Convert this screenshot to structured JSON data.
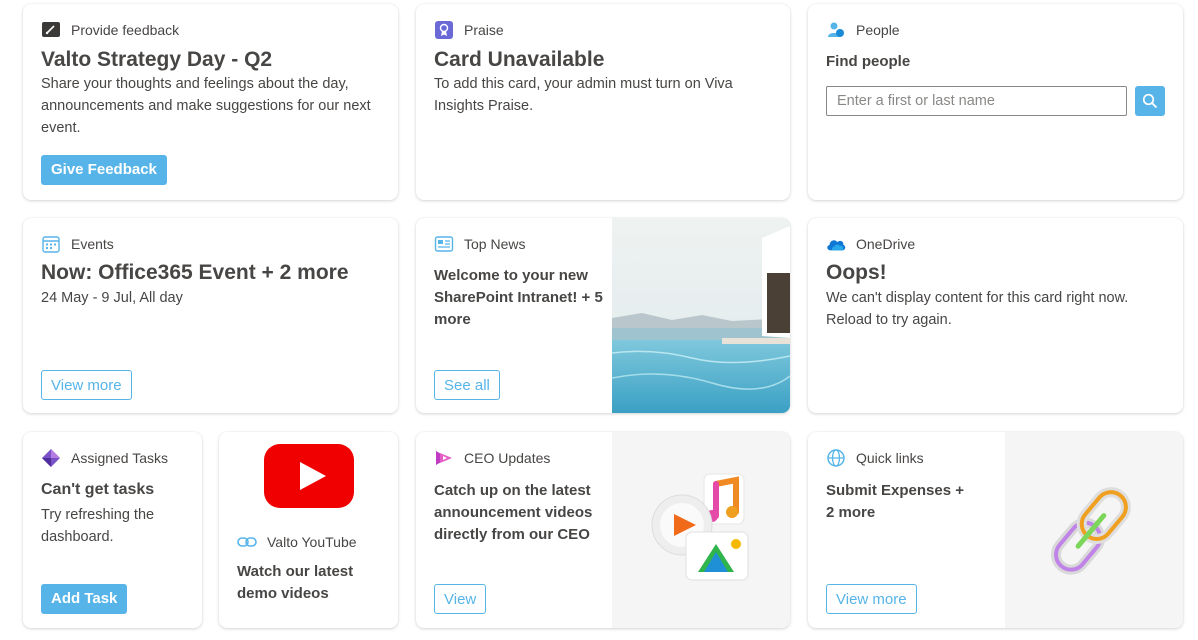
{
  "feedback": {
    "header": "Provide feedback",
    "title": "Valto Strategy Day - Q2",
    "body": "Share your thoughts and feelings about the day, announcements and make suggestions for our next event.",
    "button": "Give Feedback"
  },
  "praise": {
    "header": "Praise",
    "title": "Card Unavailable",
    "body": "To add this card, your admin must turn on Viva Insights Praise."
  },
  "people": {
    "header": "People",
    "find_label": "Find people",
    "placeholder": "Enter a first or last name"
  },
  "events": {
    "header": "Events",
    "title": "Now: Office365 Event + 2 more",
    "body": "24 May - 9 Jul, All day",
    "button": "View more"
  },
  "news": {
    "header": "Top News",
    "body": "Welcome to your new SharePoint Intranet! + 5 more",
    "button": "See all"
  },
  "onedrive": {
    "header": "OneDrive",
    "title": "Oops!",
    "body": "We can't display content for this card right now. Reload to try again."
  },
  "tasks": {
    "header": "Assigned Tasks",
    "title": "Can't get tasks",
    "body": "Try refreshing the dashboard.",
    "button": "Add Task"
  },
  "youtube": {
    "header": "Valto YouTube",
    "body": "Watch our latest demo videos"
  },
  "ceo": {
    "header": "CEO Updates",
    "body": "Catch up on the latest announcement videos directly from our CEO",
    "button": "View"
  },
  "quicklinks": {
    "header": "Quick links",
    "body": "Submit Expenses + 2 more",
    "button": "View more"
  },
  "colors": {
    "accent": "#56b4e9",
    "text": "#484644"
  }
}
